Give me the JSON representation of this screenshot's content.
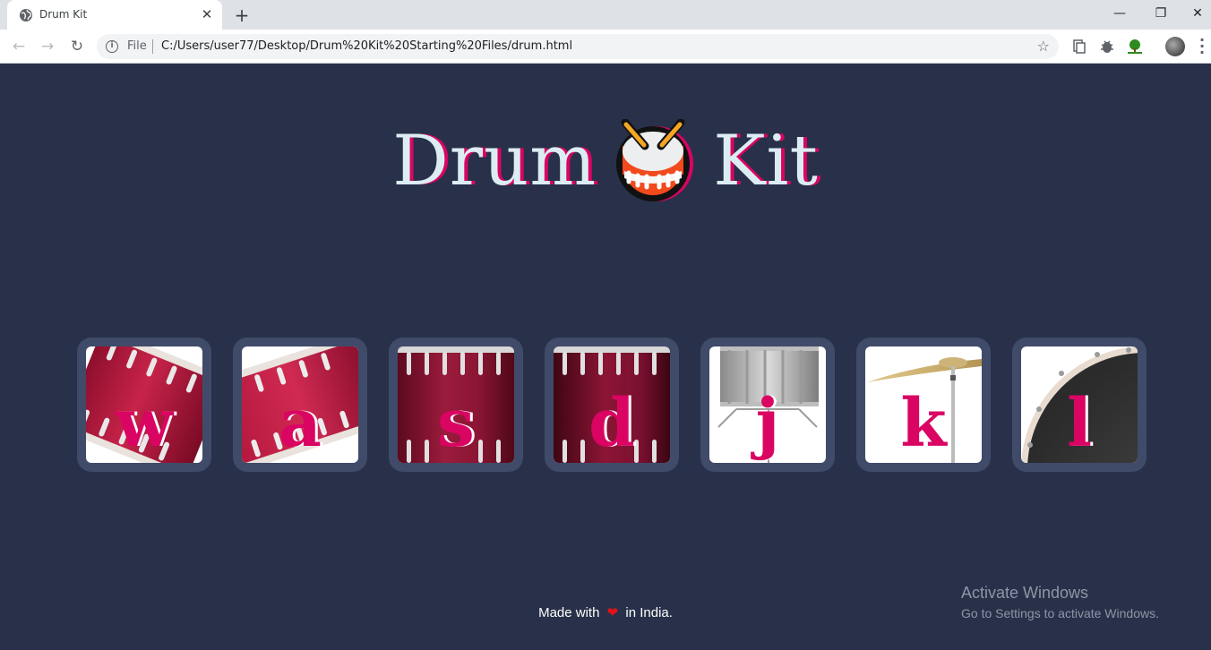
{
  "browser": {
    "tab_title": "Drum Kit",
    "address_scheme": "File",
    "address_url": "C:/Users/user77/Desktop/Drum%20Kit%20Starting%20Files/drum.html",
    "icons": {
      "back": "arrow-left-icon",
      "forward": "arrow-right-icon",
      "reload": "reload-icon",
      "info": "info-icon",
      "bookmark": "star-icon",
      "tab_close": "close-icon",
      "new_tab": "plus-icon"
    }
  },
  "page": {
    "title_part1": "Drum",
    "title_part2": "Kit",
    "title_icon": "drum-emoji",
    "drums": [
      {
        "key": "w",
        "name": "tom-1"
      },
      {
        "key": "a",
        "name": "tom-2"
      },
      {
        "key": "s",
        "name": "tom-3"
      },
      {
        "key": "d",
        "name": "tom-4"
      },
      {
        "key": "j",
        "name": "snare"
      },
      {
        "key": "k",
        "name": "crash"
      },
      {
        "key": "l",
        "name": "kick-bass"
      }
    ],
    "footer_before": "Made with",
    "footer_after": "in India.",
    "colors": {
      "background": "#283149",
      "button_bg": "#404b69",
      "accent": "#da0463",
      "title": "#dbedf3"
    }
  },
  "watermark": {
    "title": "Activate Windows",
    "subtitle": "Go to Settings to activate Windows."
  }
}
